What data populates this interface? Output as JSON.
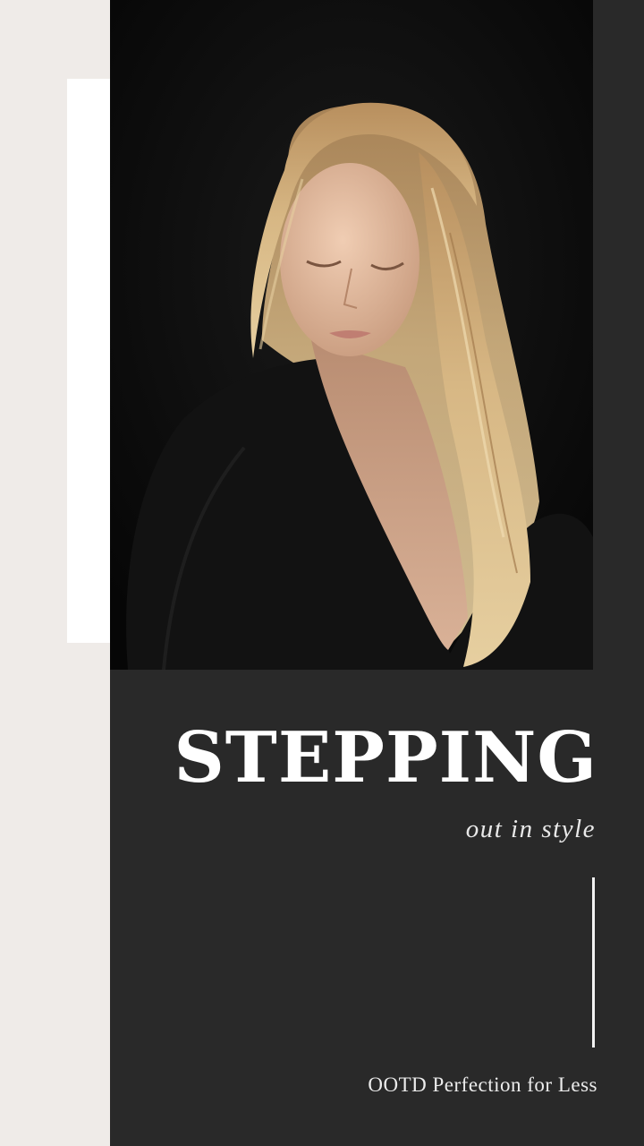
{
  "story": {
    "title": "STEPPING",
    "subtitle": "out in style",
    "tagline": "OOTD Perfection for Less"
  },
  "colors": {
    "background": "#efebe8",
    "panel": "#292929",
    "photo_background": "#0b0b0b",
    "text": "#ffffff"
  }
}
